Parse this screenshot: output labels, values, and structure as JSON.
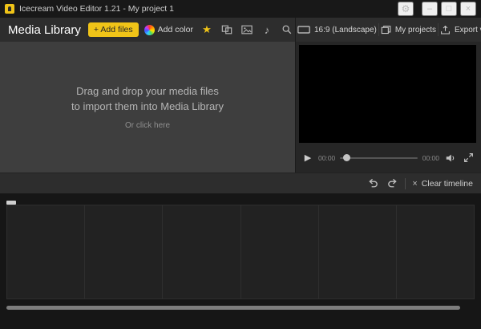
{
  "titlebar": {
    "title": "Icecream Video Editor 1.21 - My project 1",
    "settings_glyph": "⚙",
    "minimize_glyph": "–",
    "maximize_glyph": "□",
    "close_glyph": "×"
  },
  "media_library": {
    "title": "Media Library",
    "add_files_label": "+ Add files",
    "add_color_label": "Add color",
    "star_glyph": "★",
    "music_glyph": "♪",
    "collapse_glyph": "‹"
  },
  "project_bar": {
    "aspect_label": "16:9 (Landscape)",
    "my_projects_label": "My projects",
    "export_label": "Export video"
  },
  "dropzone": {
    "line1": "Drag and drop your media files",
    "line2": "to import them into Media Library",
    "hint": "Or click here"
  },
  "player": {
    "play_glyph": "▶",
    "current_time": "00:00",
    "duration": "00:00"
  },
  "timeline_bar": {
    "clear_icon": "×",
    "clear_label": "Clear timeline"
  },
  "colors": {
    "accent": "#f0c418"
  }
}
